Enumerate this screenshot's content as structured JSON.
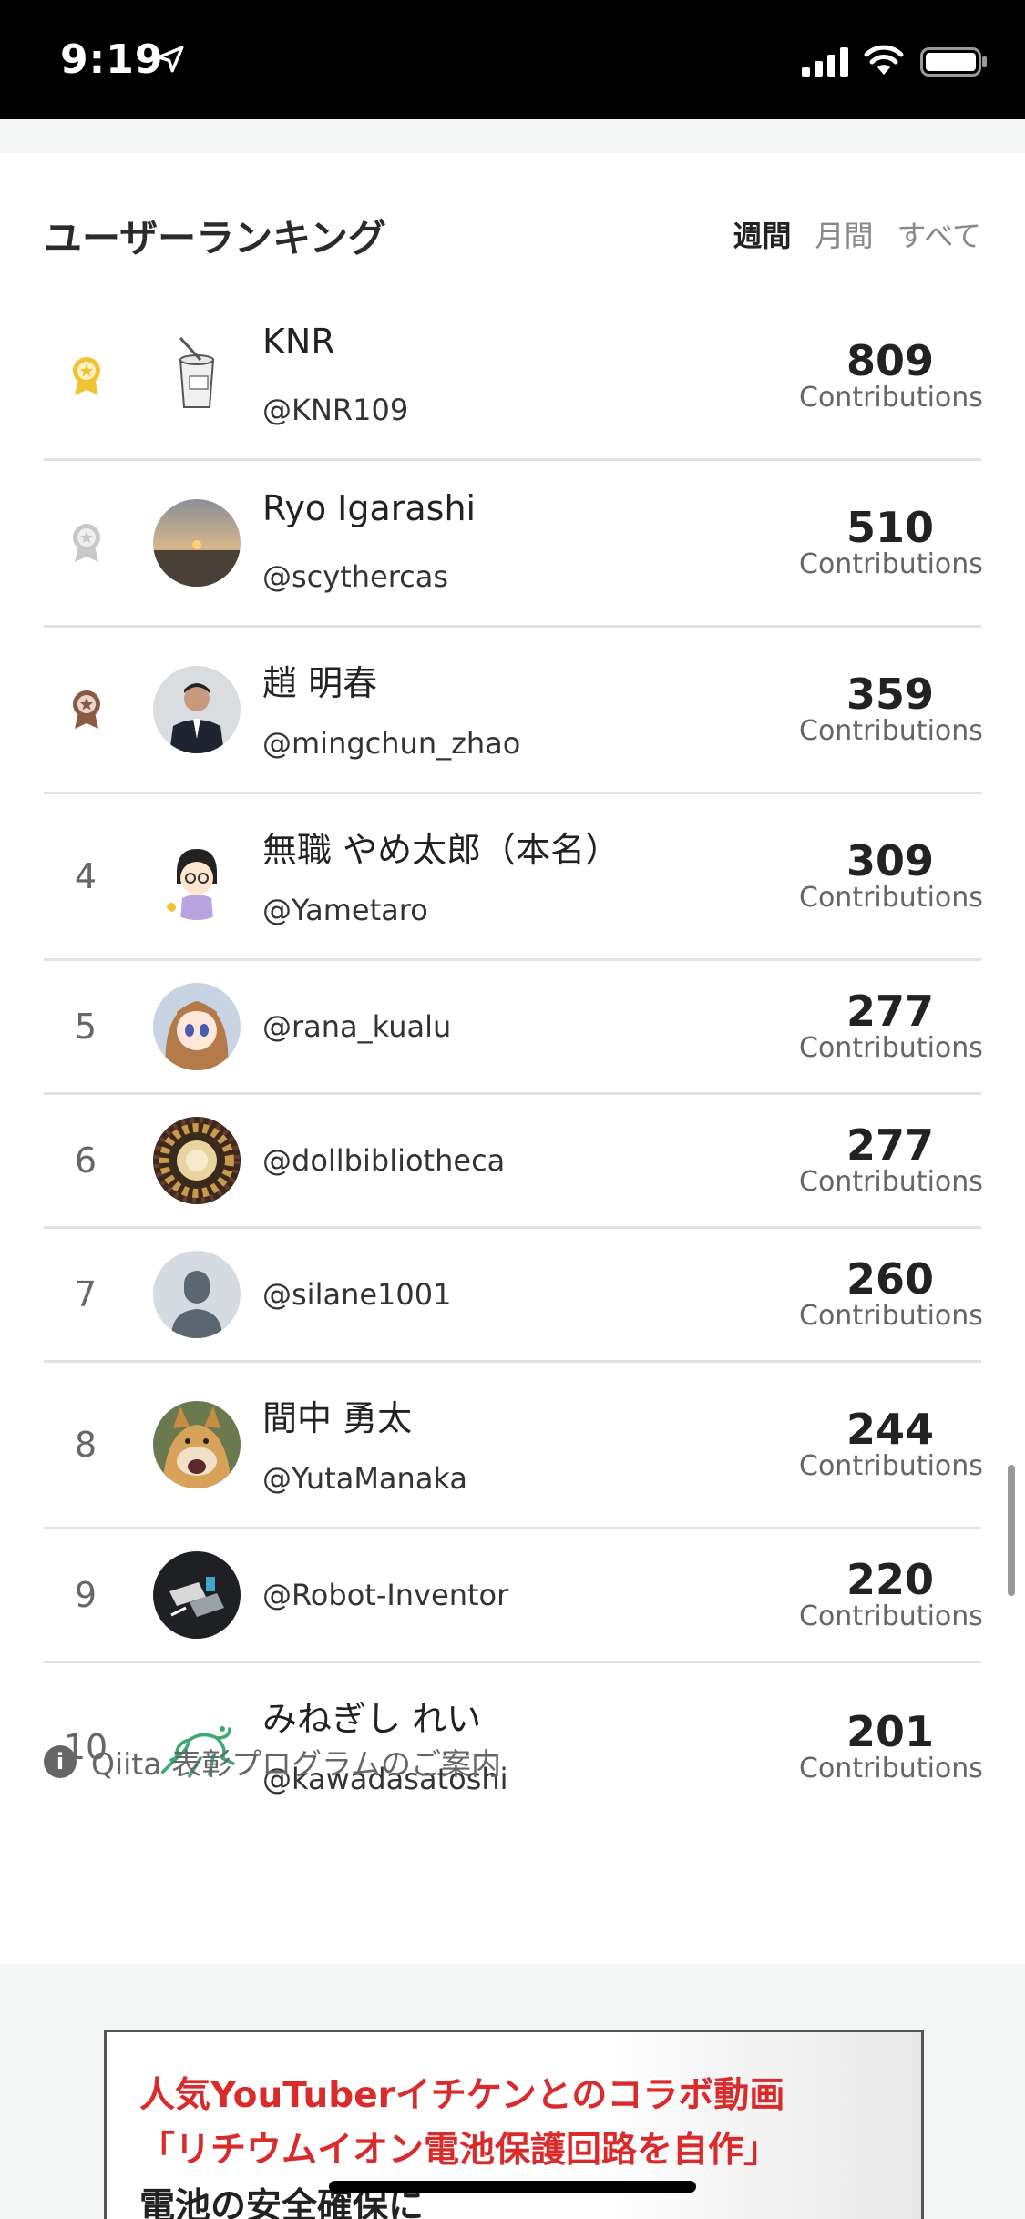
{
  "status_bar": {
    "time": "9:19"
  },
  "ranking": {
    "title": "ユーザーランキング",
    "tabs": [
      {
        "label": "週間",
        "active": true
      },
      {
        "label": "月間",
        "active": false
      },
      {
        "label": "すべて",
        "active": false
      }
    ],
    "entries": [
      {
        "rank": "1",
        "medal": "gold",
        "name": "KNR",
        "handle": "@KNR109",
        "score": "809",
        "score_label": "Contributions"
      },
      {
        "rank": "2",
        "medal": "silver",
        "name": "Ryo Igarashi",
        "handle": "@scythercas",
        "score": "510",
        "score_label": "Contributions"
      },
      {
        "rank": "3",
        "medal": "bronze",
        "name": "趙 明春",
        "handle": "@mingchun_zhao",
        "score": "359",
        "score_label": "Contributions"
      },
      {
        "rank": "4",
        "name": "無職 やめ太郎（本名）",
        "handle": "@Yametaro",
        "score": "309",
        "score_label": "Contributions"
      },
      {
        "rank": "5",
        "name": "",
        "handle": "@rana_kualu",
        "score": "277",
        "score_label": "Contributions"
      },
      {
        "rank": "6",
        "name": "",
        "handle": "@dollbibliotheca",
        "score": "277",
        "score_label": "Contributions"
      },
      {
        "rank": "7",
        "name": "",
        "handle": "@silane1001",
        "score": "260",
        "score_label": "Contributions"
      },
      {
        "rank": "8",
        "name": "間中 勇太",
        "handle": "@YutaManaka",
        "score": "244",
        "score_label": "Contributions"
      },
      {
        "rank": "9",
        "name": "",
        "handle": "@Robot-Inventor",
        "score": "220",
        "score_label": "Contributions"
      },
      {
        "rank": "10",
        "name": "みねぎし れい",
        "handle": "@kawadasatoshi",
        "score": "201",
        "score_label": "Contributions"
      }
    ],
    "program_link": "Qiita 表彰プログラムのご案内"
  },
  "ad": {
    "line1": "人気YouTuberイチケンとのコラボ動画",
    "line2": "「リチウムイオン電池保護回路を自作」",
    "line3": "電池の安全確保に"
  },
  "colors": {
    "gold": "#f2c230",
    "silver": "#c8c8c8",
    "bronze": "#8a5a44"
  }
}
